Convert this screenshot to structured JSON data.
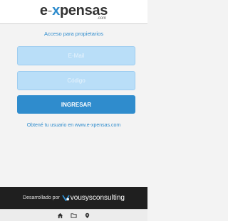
{
  "header": {
    "logo": {
      "part_e": "e",
      "part_dash": "-",
      "part_x": "x",
      "part_rest": "pensas",
      "suffix": ".com"
    }
  },
  "login": {
    "subtitle": "Acceso para propietarios",
    "email_placeholder": "E-Mail",
    "code_placeholder": "Código",
    "submit_label": "INGRESAR",
    "help_link": "Obtené tu usuario en www.e-xpensas.com"
  },
  "footer": {
    "developed_by": "Desarrollado por",
    "brand_part1": "vousys",
    "brand_part2": "consulting"
  },
  "navbar": {
    "icons": [
      "home-icon",
      "folder-icon",
      "location-pin-icon"
    ]
  },
  "colors": {
    "accent": "#2f8ccd",
    "input_fill": "#b9def8",
    "background": "#f3f3f3",
    "footer": "#1f1f1f"
  }
}
